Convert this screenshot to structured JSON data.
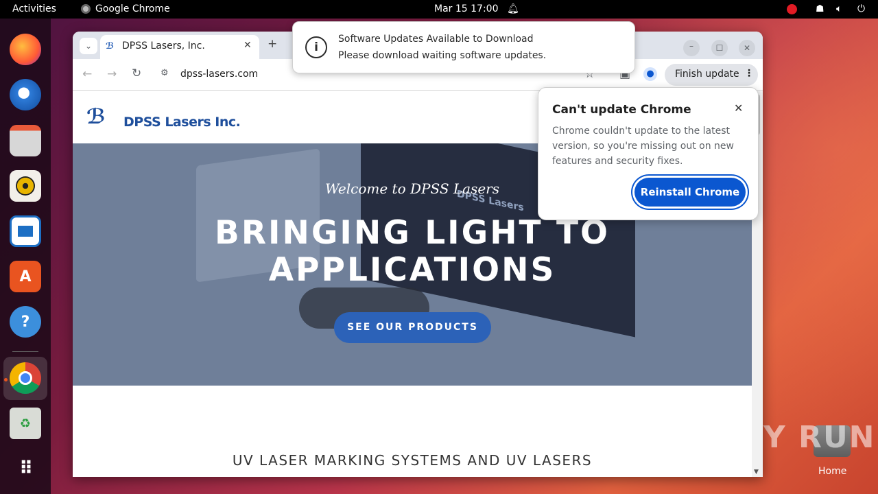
{
  "topbar": {
    "activities": "Activities",
    "app": "Google Chrome",
    "datetime": "Mar 15  17:00"
  },
  "browser": {
    "tab_title": "DPSS Lasers, Inc.",
    "url": "dpss-lasers.com",
    "finish_update": "Finish update"
  },
  "site": {
    "logo_text": "DPSS Lasers Inc.",
    "welcome": "Welcome to DPSS Lasers",
    "headline_1": "BRINGING LIGHT TO",
    "headline_2": "APPLICATIONS",
    "cta": "SEE OUR PRODUCTS",
    "section_title": "UV LASER MARKING SYSTEMS AND UV LASERS",
    "device_label": "DPSS Lasers"
  },
  "notification": {
    "title": "Software Updates Available to Download",
    "body": "Please download waiting software updates."
  },
  "update_bubble": {
    "title": "Can't update Chrome",
    "body": "Chrome couldn't update to the latest version, so you're missing out on new features and security fixes.",
    "button": "Reinstall Chrome"
  },
  "desktop": {
    "home_label": "Home",
    "watermark": "ANY RUN"
  },
  "colors": {
    "accent": "#0b57d0",
    "cta": "#2c62b8",
    "logo": "#1f4f9c",
    "hero": "#6f7f99"
  }
}
